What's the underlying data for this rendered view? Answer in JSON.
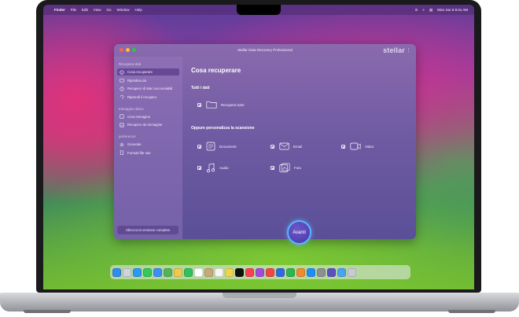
{
  "menubar": {
    "app_name": "Finder",
    "items": [
      "File",
      "Edit",
      "View",
      "Go",
      "Window",
      "Help"
    ],
    "clock": "Mon Jun 5  9:41 AM"
  },
  "window": {
    "title": "Stellar Data Recovery Professional",
    "brand": "stellar"
  },
  "sidebar": {
    "sections": [
      {
        "heading": "Recupera dati",
        "items": [
          {
            "label": "Cosa recuperare",
            "icon": "target-icon",
            "active": true
          },
          {
            "label": "Ripristina da",
            "icon": "folder-icon"
          },
          {
            "label": "Recupero di Mac non avviabili",
            "icon": "drive-icon"
          },
          {
            "label": "Riprendi il recupero",
            "icon": "resume-icon"
          }
        ]
      },
      {
        "heading": "Immagine disco",
        "items": [
          {
            "label": "Crea immagine",
            "icon": "image-icon"
          },
          {
            "label": "Recupero da immagine",
            "icon": "image-recover-icon"
          }
        ]
      },
      {
        "heading": "preferenze",
        "items": [
          {
            "label": "Generale",
            "icon": "gear-icon"
          },
          {
            "label": "Formati file raw",
            "icon": "file-raw-icon"
          }
        ]
      }
    ],
    "activate_button": "Sblocca la versione completa"
  },
  "main": {
    "title": "Cosa recuperare",
    "all_data_heading": "Tutti i dati",
    "recover_all_label": "Recupera tutto",
    "customize_heading": "Oppure personalizza la scansione",
    "options": [
      {
        "label": "Documenti",
        "icon": "document-icon"
      },
      {
        "label": "Email",
        "icon": "email-icon"
      },
      {
        "label": "Video",
        "icon": "video-icon"
      },
      {
        "label": "Audio",
        "icon": "music-icon"
      },
      {
        "label": "Foto",
        "icon": "photo-icon"
      }
    ],
    "next_button": "Avanti"
  },
  "dock": {
    "icons": [
      "finder-icon",
      "launchpad-icon",
      "safari-icon",
      "messages-icon",
      "mail-icon",
      "maps-icon",
      "photos-icon",
      "facetime-icon",
      "calendar-icon",
      "contacts-icon",
      "reminders-icon",
      "notes-icon",
      "tv-icon",
      "music-icon",
      "podcasts-icon",
      "news-icon",
      "keynote-icon",
      "numbers-icon",
      "pages-icon",
      "appstore-icon",
      "settings-icon",
      "stellar-icon",
      "downloads-icon",
      "trash-icon"
    ],
    "colors": [
      "#2f8cf0",
      "#cfd3da",
      "#2a9af5",
      "#34c759",
      "#3a8ff5",
      "#52b35c",
      "#f0c94a",
      "#2fc25c",
      "#ffffff",
      "#c9a87a",
      "#f5f5f5",
      "#f3d34e",
      "#111111",
      "#fa3e58",
      "#a04adf",
      "#f24545",
      "#2d6cdf",
      "#2fb44f",
      "#f08a2b",
      "#1e8df6",
      "#8e8e93",
      "#5b4fc2",
      "#4aa3f0",
      "#c8ccd2"
    ]
  }
}
